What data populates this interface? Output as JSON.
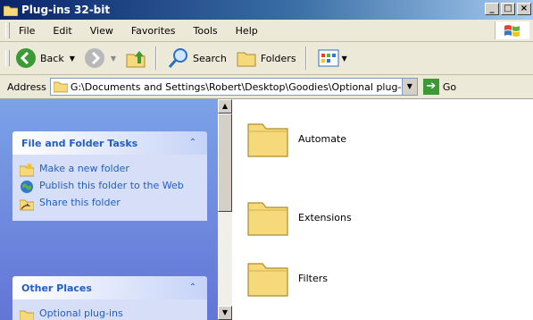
{
  "window": {
    "title": "Plug-ins 32-bit",
    "controls": {
      "minimize": "_",
      "maximize": "□",
      "close": "×"
    }
  },
  "menu": {
    "items": [
      "File",
      "Edit",
      "View",
      "Favorites",
      "Tools",
      "Help"
    ]
  },
  "toolbar": {
    "back_label": "Back",
    "search_label": "Search",
    "folders_label": "Folders"
  },
  "address": {
    "label": "Address",
    "value": "G:\\Documents and Settings\\Robert\\Desktop\\Goodies\\Optional plug-ins",
    "go_label": "Go"
  },
  "tasks": {
    "file_folder": {
      "title": "File and Folder Tasks",
      "items": [
        {
          "label": "Make a new folder",
          "icon": "new-folder-icon"
        },
        {
          "label": "Publish this folder to the Web",
          "icon": "publish-web-icon"
        },
        {
          "label": "Share this folder",
          "icon": "share-folder-icon"
        }
      ]
    },
    "other_places": {
      "title": "Other Places",
      "items": [
        {
          "label": "Optional plug-ins",
          "icon": "folder-icon"
        }
      ]
    }
  },
  "files": [
    {
      "name": "Automate"
    },
    {
      "name": "Extensions"
    },
    {
      "name": "Filters"
    }
  ],
  "colors": {
    "title_bar": "#0a246a",
    "task_pane": "#6375d6",
    "task_link": "#215dc6",
    "folder": "#f5d97a"
  }
}
